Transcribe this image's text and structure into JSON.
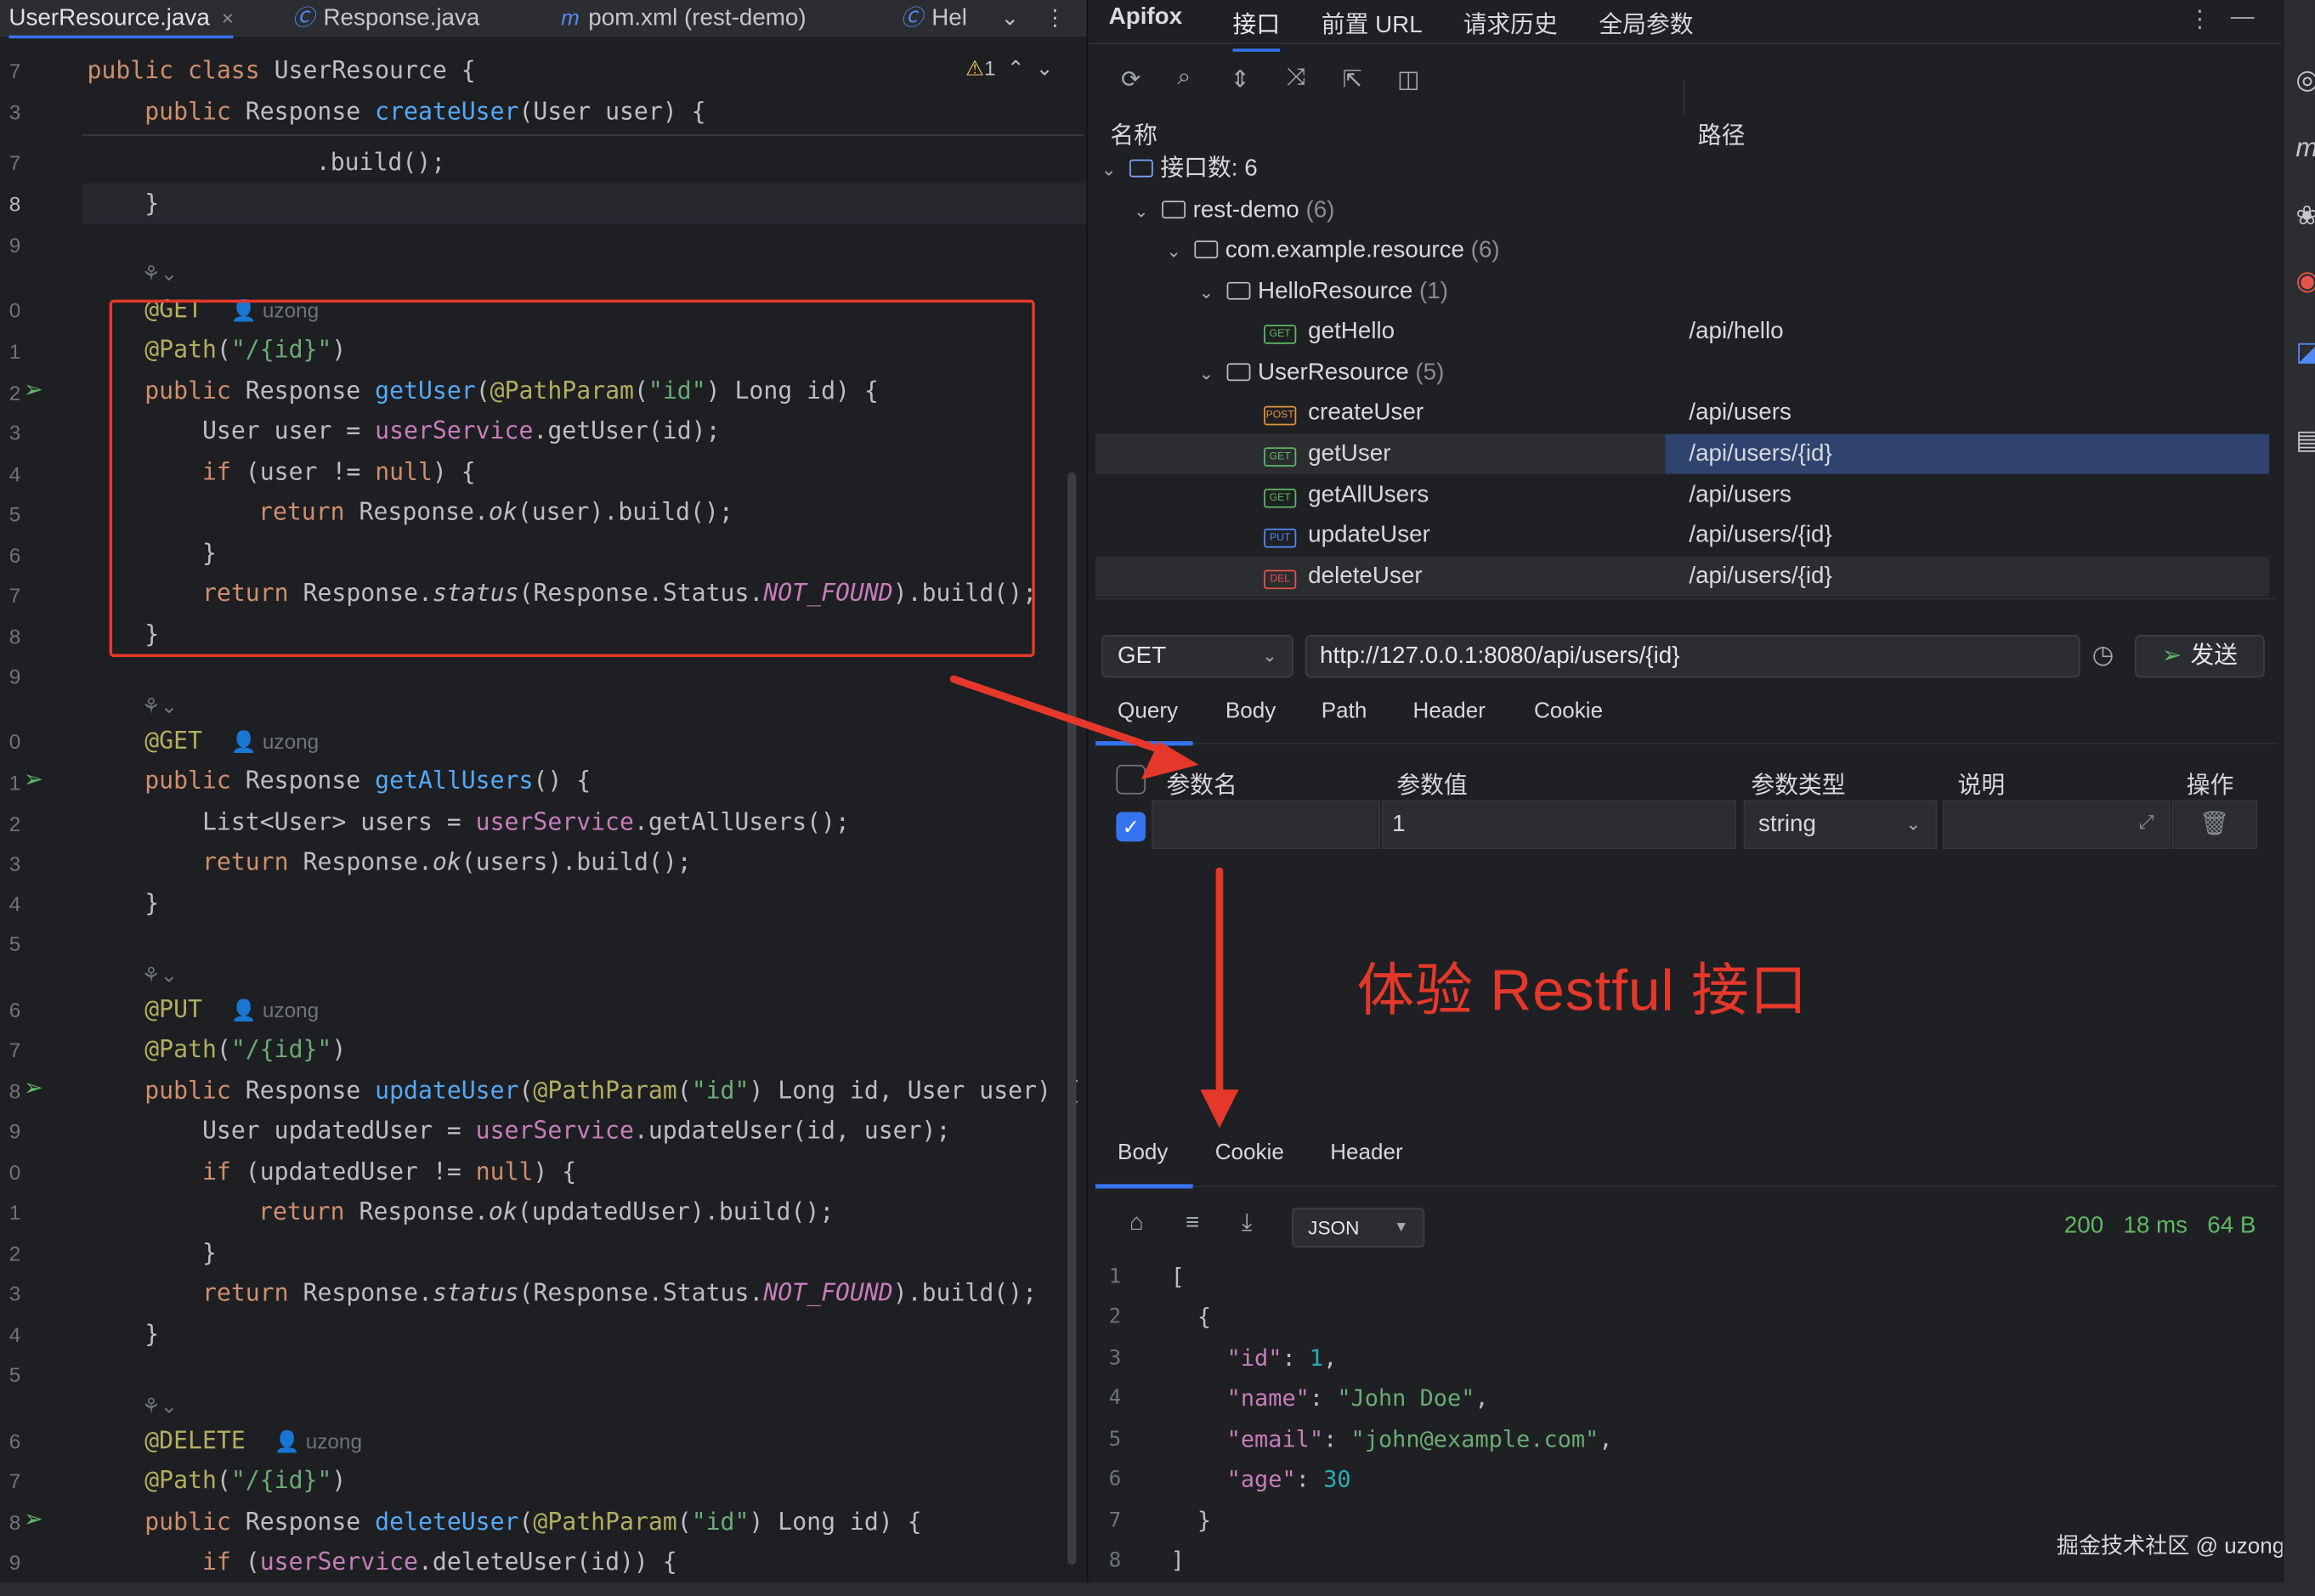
{
  "editor": {
    "tabs": [
      {
        "label": "UserResource.java",
        "icon": "java-class-icon",
        "close": "×"
      },
      {
        "label": "Response.java",
        "icon": "java-class-icon"
      },
      {
        "label": "pom.xml (rest-demo)",
        "icon": "maven-icon"
      },
      {
        "label": "Hel",
        "icon": "java-class-icon"
      }
    ],
    "tab_tools": {
      "more": "⌄",
      "menu": "⋮"
    },
    "warnings": "1",
    "hints": {
      "author": "uzong"
    },
    "line_numbers": [
      "7",
      "3",
      "7",
      "8",
      "9",
      "0",
      "1",
      "2",
      "3",
      "4",
      "5",
      "6",
      "7",
      "8",
      "9",
      "0",
      "1",
      "2",
      "3",
      "4",
      "5",
      "6",
      "7",
      "8",
      "9",
      "0",
      "1",
      "2",
      "3",
      "4",
      "5",
      "6",
      "7",
      "8",
      "9"
    ]
  },
  "apifox": {
    "title": "Apifox",
    "tabs": [
      "接口",
      "前置 URL",
      "请求历史",
      "全局参数"
    ],
    "col_name": "名称",
    "col_path": "路径",
    "tree": {
      "root": {
        "label": "接口数: 6"
      },
      "project": {
        "label": "rest-demo",
        "count": "(6)"
      },
      "package": {
        "label": "com.example.resource",
        "count": "(6)"
      },
      "hello": {
        "label": "HelloResource",
        "count": "(1)"
      },
      "user": {
        "label": "UserResource",
        "count": "(5)"
      },
      "endpoints": [
        {
          "method": "GET",
          "name": "getHello",
          "path": "/api/hello"
        },
        {
          "method": "POST",
          "name": "createUser",
          "path": "/api/users"
        },
        {
          "method": "GET",
          "name": "getUser",
          "path": "/api/users/{id}"
        },
        {
          "method": "GET",
          "name": "getAllUsers",
          "path": "/api/users"
        },
        {
          "method": "PUT",
          "name": "updateUser",
          "path": "/api/users/{id}"
        },
        {
          "method": "DEL",
          "name": "deleteUser",
          "path": "/api/users/{id}"
        }
      ]
    },
    "request": {
      "method": "GET",
      "url": "http://127.0.0.1:8080/api/users/{id}",
      "send": "发送",
      "tabs": [
        "Query",
        "Body",
        "Path",
        "Header",
        "Cookie"
      ],
      "params_header": [
        "参数名",
        "参数值",
        "参数类型",
        "说明",
        "操作"
      ],
      "param_row": {
        "name": "",
        "value": "1",
        "type": "string",
        "desc": ""
      }
    },
    "annotation": "体验 Restful 接口",
    "response": {
      "tabs": [
        "Body",
        "Cookie",
        "Header"
      ],
      "format": "JSON",
      "status": "200",
      "time": "18 ms",
      "size": "64 B"
    },
    "watermark": "掘金技术社区 @ uzong"
  }
}
